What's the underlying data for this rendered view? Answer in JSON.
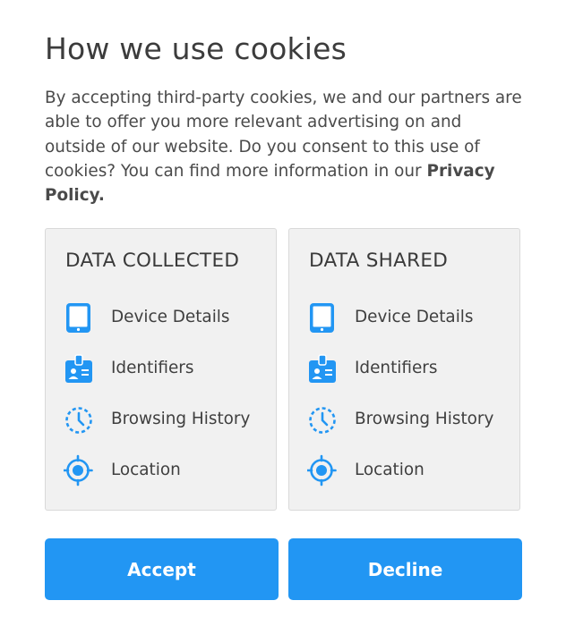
{
  "dialog": {
    "title": "How we use cookies",
    "body": "By accepting third-party cookies, we and our partners are able to offer you more relevant advertising on and outside of our website. Do you consent to this use of cookies? You can find more information in our ",
    "link": "Privacy Policy."
  },
  "collected": {
    "title": "DATA COLLECTED",
    "items": [
      {
        "icon": "tablet-icon",
        "label": "Device Details"
      },
      {
        "icon": "id-badge-icon",
        "label": "Identifiers"
      },
      {
        "icon": "history-clock-icon",
        "label": "Browsing History"
      },
      {
        "icon": "location-target-icon",
        "label": "Location"
      }
    ]
  },
  "shared": {
    "title": "DATA SHARED",
    "items": [
      {
        "icon": "tablet-icon",
        "label": "Device Details"
      },
      {
        "icon": "id-badge-icon",
        "label": "Identifiers"
      },
      {
        "icon": "history-clock-icon",
        "label": "Browsing History"
      },
      {
        "icon": "location-target-icon",
        "label": "Location"
      }
    ]
  },
  "buttons": {
    "accept": "Accept",
    "decline": "Decline"
  },
  "colors": {
    "accent": "#2296f3",
    "card_bg": "#f1f1f1",
    "text": "#3f3f3f"
  }
}
